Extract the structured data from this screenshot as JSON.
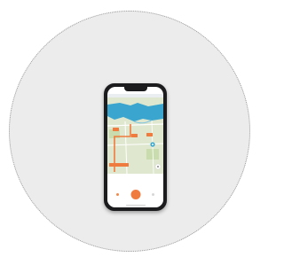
{
  "colors": {
    "accent": "#f07b3f",
    "water": "#3aa6d0",
    "land": "#dfe7cf",
    "background_disc": "#ececec"
  },
  "icons": {
    "map_pin": "map-pin-icon",
    "locate": "locate-icon",
    "tab_home": "home-icon",
    "tab_profile": "profile-icon"
  }
}
